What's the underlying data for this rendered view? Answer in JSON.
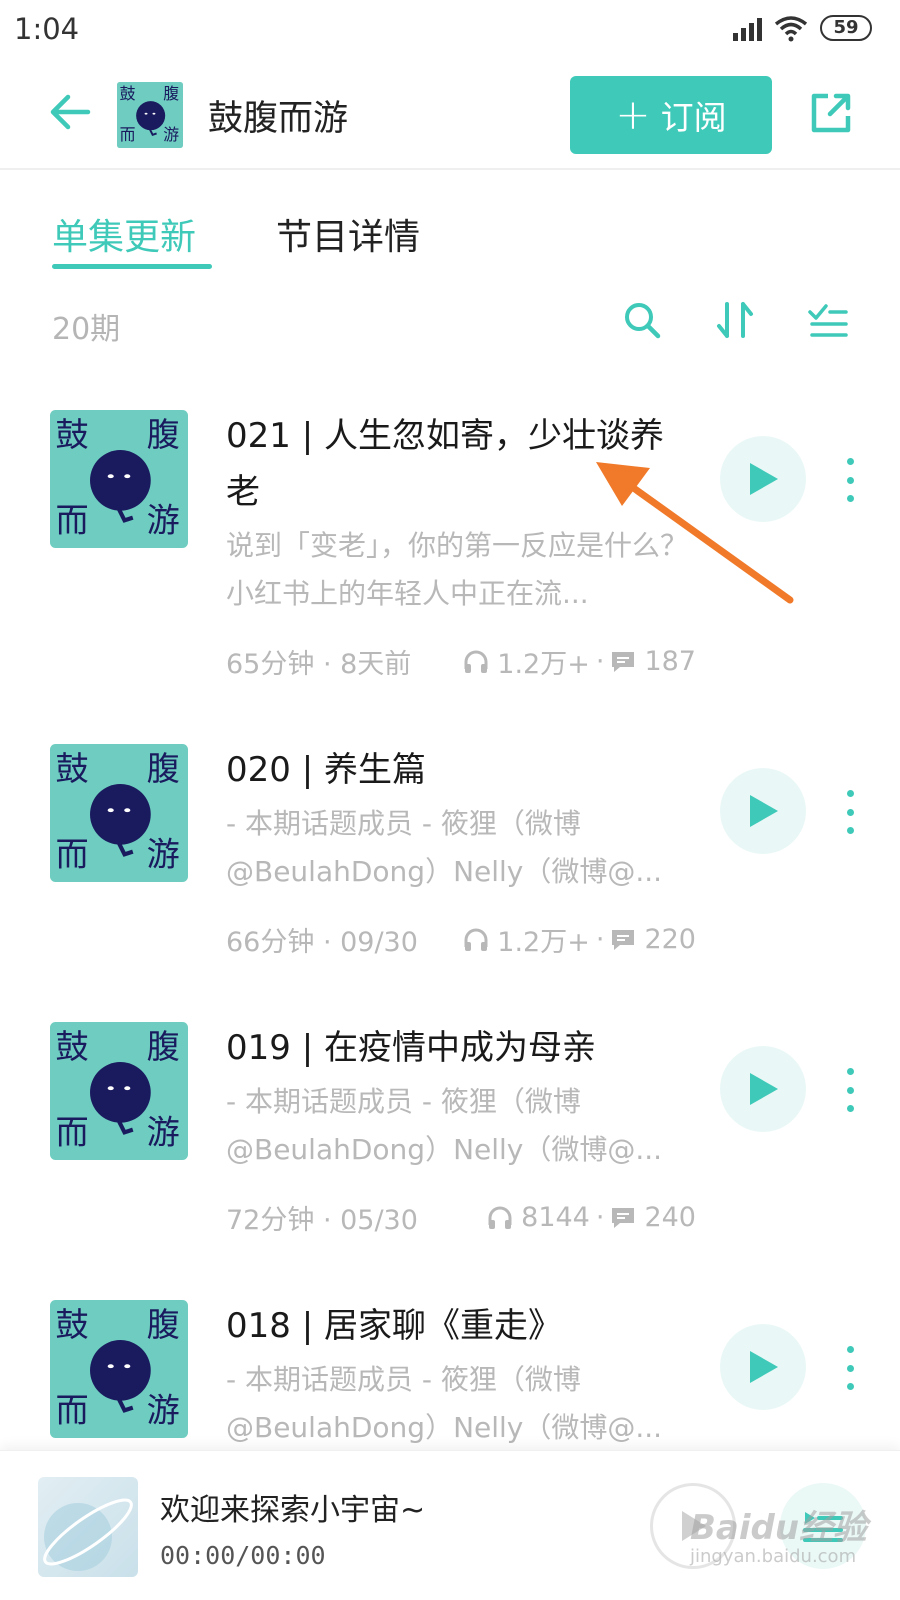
{
  "status_bar": {
    "time": "1:04",
    "battery": "59"
  },
  "header": {
    "title": "鼓腹而游",
    "subscribe_label": "订阅",
    "subscribe_plus": "+"
  },
  "tabs": [
    {
      "label": "单集更新",
      "active": true
    },
    {
      "label": "节目详情",
      "active": false
    }
  ],
  "episode_count": "20期",
  "cover_text": {
    "tl": "鼓",
    "tr": "腹",
    "bl": "而",
    "br": "游"
  },
  "episodes": [
    {
      "title": "021 | 人生忽如寄，少壮谈养老",
      "desc": "说到「变老」，你的第一反应是什么？小红书上的年轻人中正在流...",
      "duration_date": "65分钟 · 8天前",
      "plays": "1.2万+",
      "comments": "187"
    },
    {
      "title": "020 | 养生篇",
      "desc": "- 本期话题成员 - 筱狸（微博@BeulahDong）Nelly（微博@...",
      "duration_date": "66分钟 · 09/30",
      "plays": "1.2万+",
      "comments": "220"
    },
    {
      "title": "019 | 在疫情中成为母亲",
      "desc": "- 本期话题成员 - 筱狸（微博@BeulahDong）Nelly（微博@...",
      "duration_date": "72分钟 · 05/30",
      "plays": "8144",
      "comments": "240"
    },
    {
      "title": "018 | 居家聊《重走》",
      "desc": "- 本期话题成员 - 筱狸（微博@BeulahDong）Nelly（微博@...",
      "duration_date": "",
      "plays": "",
      "comments": ""
    }
  ],
  "player": {
    "title": "欢迎来探索小宇宙~",
    "time": "00:00/00:00"
  },
  "watermark": {
    "main": "Baidu经验",
    "sub": "jingyan.baidu.com"
  },
  "colors": {
    "accent": "#3ec9b8",
    "cover_bg": "#6ecdc0",
    "cover_face": "#1a1a5e",
    "arrow": "#f07a2a"
  },
  "icons": {
    "back": "back-arrow-icon",
    "share": "share-icon",
    "search": "search-icon",
    "sort": "sort-icon",
    "filter": "filter-list-icon",
    "play": "play-icon",
    "more": "more-vertical-icon",
    "headphones": "headphones-icon",
    "comment": "comment-icon",
    "playlist": "playlist-icon"
  }
}
